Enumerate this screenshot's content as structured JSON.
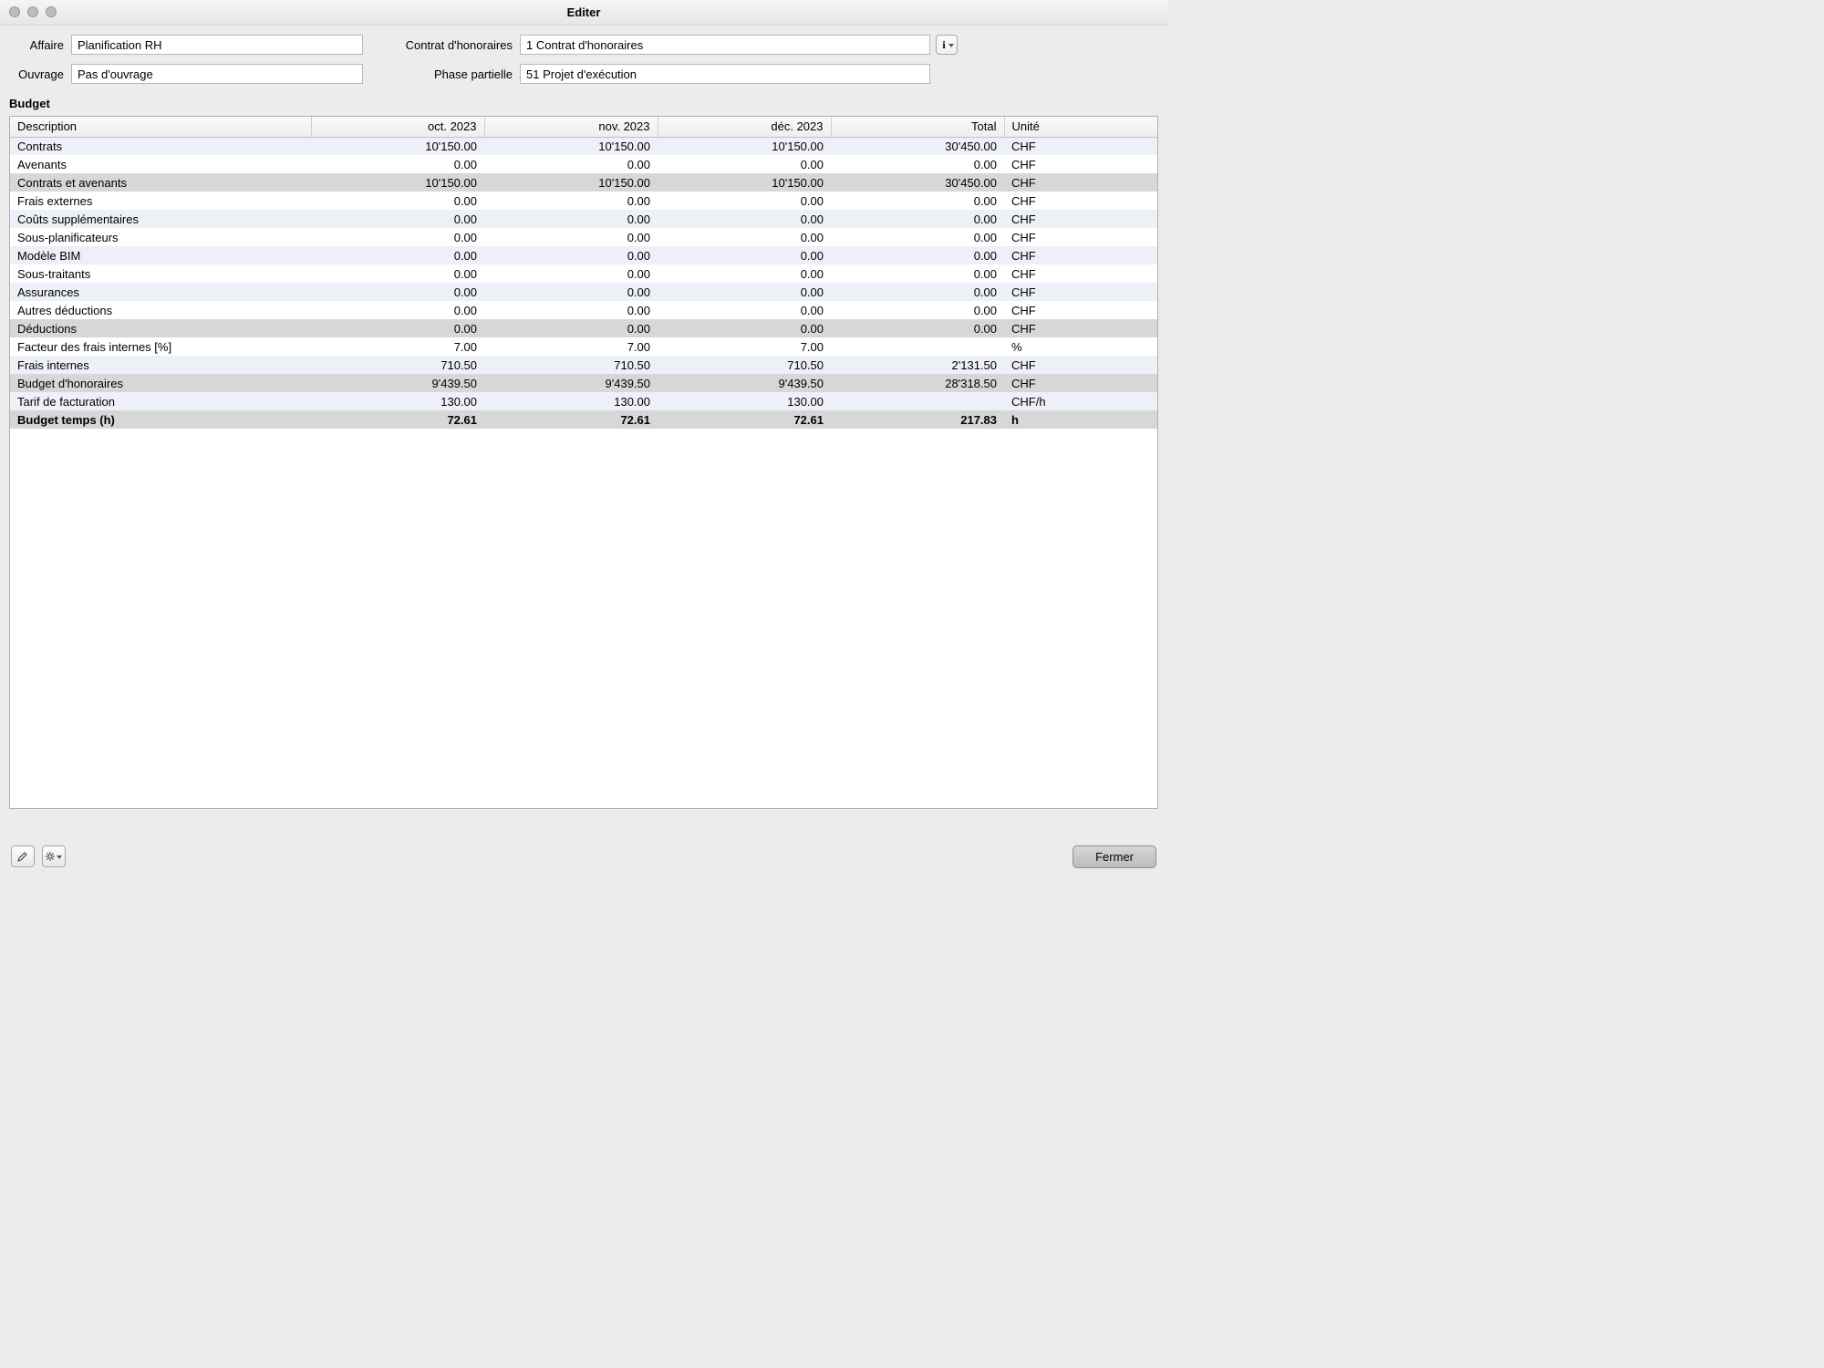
{
  "window": {
    "title": "Editer"
  },
  "form": {
    "labels": {
      "affaire": "Affaire",
      "contrat": "Contrat d'honoraires",
      "ouvrage": "Ouvrage",
      "phase": "Phase partielle"
    },
    "values": {
      "affaire": "Planification RH",
      "contrat": "1 Contrat d'honoraires",
      "ouvrage": "Pas d'ouvrage",
      "phase": "51 Projet d'exécution"
    },
    "infoGlyph": "i"
  },
  "section": {
    "budget": "Budget"
  },
  "table": {
    "headers": {
      "description": "Description",
      "m1": "oct. 2023",
      "m2": "nov. 2023",
      "m3": "déc. 2023",
      "total": "Total",
      "unit": "Unité"
    },
    "rows": [
      {
        "desc": "Contrats",
        "m1": "10'150.00",
        "m2": "10'150.00",
        "m3": "10'150.00",
        "total": "30'450.00",
        "unit": "CHF",
        "style": "alt"
      },
      {
        "desc": "Avenants",
        "m1": "0.00",
        "m2": "0.00",
        "m3": "0.00",
        "total": "0.00",
        "unit": "CHF",
        "style": ""
      },
      {
        "desc": "Contrats et avenants",
        "m1": "10'150.00",
        "m2": "10'150.00",
        "m3": "10'150.00",
        "total": "30'450.00",
        "unit": "CHF",
        "style": "shade"
      },
      {
        "desc": "Frais externes",
        "m1": "0.00",
        "m2": "0.00",
        "m3": "0.00",
        "total": "0.00",
        "unit": "CHF",
        "style": ""
      },
      {
        "desc": "Coûts supplémentaires",
        "m1": "0.00",
        "m2": "0.00",
        "m3": "0.00",
        "total": "0.00",
        "unit": "CHF",
        "style": "alt"
      },
      {
        "desc": "Sous-planificateurs",
        "m1": "0.00",
        "m2": "0.00",
        "m3": "0.00",
        "total": "0.00",
        "unit": "CHF",
        "style": ""
      },
      {
        "desc": "Modèle BIM",
        "m1": "0.00",
        "m2": "0.00",
        "m3": "0.00",
        "total": "0.00",
        "unit": "CHF",
        "style": "alt"
      },
      {
        "desc": "Sous-traitants",
        "m1": "0.00",
        "m2": "0.00",
        "m3": "0.00",
        "total": "0.00",
        "unit": "CHF",
        "style": ""
      },
      {
        "desc": "Assurances",
        "m1": "0.00",
        "m2": "0.00",
        "m3": "0.00",
        "total": "0.00",
        "unit": "CHF",
        "style": "alt"
      },
      {
        "desc": "Autres déductions",
        "m1": "0.00",
        "m2": "0.00",
        "m3": "0.00",
        "total": "0.00",
        "unit": "CHF",
        "style": ""
      },
      {
        "desc": "Déductions",
        "m1": "0.00",
        "m2": "0.00",
        "m3": "0.00",
        "total": "0.00",
        "unit": "CHF",
        "style": "shade"
      },
      {
        "desc": "Facteur des frais internes [%]",
        "m1": "7.00",
        "m2": "7.00",
        "m3": "7.00",
        "total": "",
        "unit": "%",
        "style": ""
      },
      {
        "desc": "Frais internes",
        "m1": "710.50",
        "m2": "710.50",
        "m3": "710.50",
        "total": "2'131.50",
        "unit": "CHF",
        "style": "alt"
      },
      {
        "desc": "Budget d'honoraires",
        "m1": "9'439.50",
        "m2": "9'439.50",
        "m3": "9'439.50",
        "total": "28'318.50",
        "unit": "CHF",
        "style": "shade"
      },
      {
        "desc": "Tarif de facturation",
        "m1": "130.00",
        "m2": "130.00",
        "m3": "130.00",
        "total": "",
        "unit": "CHF/h",
        "style": "alt"
      },
      {
        "desc": "Budget temps (h)",
        "m1": "72.61",
        "m2": "72.61",
        "m3": "72.61",
        "total": "217.83",
        "unit": "h",
        "style": "shade bold"
      }
    ]
  },
  "footer": {
    "close": "Fermer"
  }
}
